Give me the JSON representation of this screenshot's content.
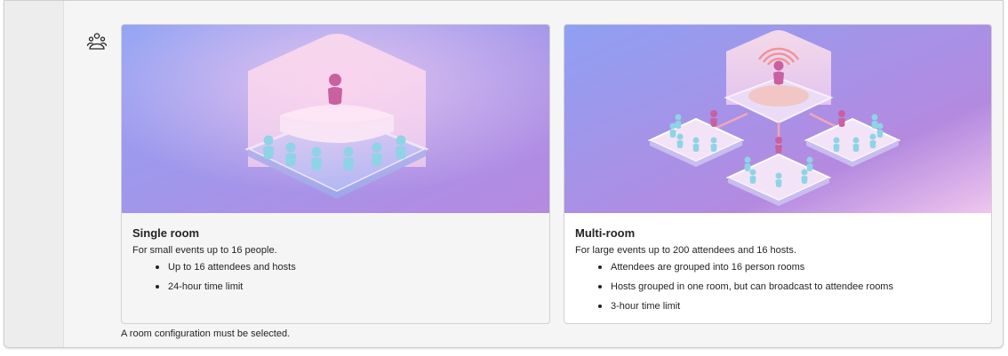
{
  "room_options": [
    {
      "title": "Single room",
      "description": "For small events up to 16 people.",
      "features": [
        "Up to 16 attendees and hosts",
        "24-hour time limit"
      ],
      "illustration": "single-room-illustration"
    },
    {
      "title": "Multi-room",
      "description": "For large events up to 200 attendees and 16 hosts.",
      "features": [
        "Attendees are grouped into 16 person rooms",
        "Hosts grouped in one room, but can broadcast to attendee rooms",
        "3-hour time limit"
      ],
      "illustration": "multi-room-illustration"
    }
  ],
  "validation_message": "A room configuration must be selected.",
  "icons": {
    "section": "people-group-icon"
  },
  "colors": {
    "illustration_bg_start": "#8ea3f5",
    "illustration_bg_end": "#b689e0",
    "host": "#c9609f",
    "attendee": "#8fd3e6"
  }
}
